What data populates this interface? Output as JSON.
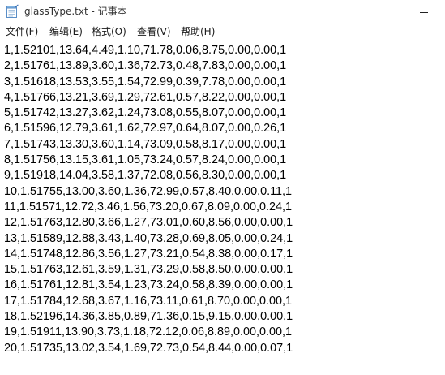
{
  "window": {
    "title": "glassType.txt - 记事本"
  },
  "icons": {
    "app": "notepad-icon",
    "minimize": "minimize-icon"
  },
  "menu": [
    "文件(F)",
    "编辑(E)",
    "格式(O)",
    "查看(V)",
    "帮助(H)"
  ],
  "document": {
    "lines": [
      "1,1.52101,13.64,4.49,1.10,71.78,0.06,8.75,0.00,0.00,1",
      "2,1.51761,13.89,3.60,1.36,72.73,0.48,7.83,0.00,0.00,1",
      "3,1.51618,13.53,3.55,1.54,72.99,0.39,7.78,0.00,0.00,1",
      "4,1.51766,13.21,3.69,1.29,72.61,0.57,8.22,0.00,0.00,1",
      "5,1.51742,13.27,3.62,1.24,73.08,0.55,8.07,0.00,0.00,1",
      "6,1.51596,12.79,3.61,1.62,72.97,0.64,8.07,0.00,0.26,1",
      "7,1.51743,13.30,3.60,1.14,73.09,0.58,8.17,0.00,0.00,1",
      "8,1.51756,13.15,3.61,1.05,73.24,0.57,8.24,0.00,0.00,1",
      "9,1.51918,14.04,3.58,1.37,72.08,0.56,8.30,0.00,0.00,1",
      "10,1.51755,13.00,3.60,1.36,72.99,0.57,8.40,0.00,0.11,1",
      "11,1.51571,12.72,3.46,1.56,73.20,0.67,8.09,0.00,0.24,1",
      "12,1.51763,12.80,3.66,1.27,73.01,0.60,8.56,0.00,0.00,1",
      "13,1.51589,12.88,3.43,1.40,73.28,0.69,8.05,0.00,0.24,1",
      "14,1.51748,12.86,3.56,1.27,73.21,0.54,8.38,0.00,0.17,1",
      "15,1.51763,12.61,3.59,1.31,73.29,0.58,8.50,0.00,0.00,1",
      "16,1.51761,12.81,3.54,1.23,73.24,0.58,8.39,0.00,0.00,1",
      "17,1.51784,12.68,3.67,1.16,73.11,0.61,8.70,0.00,0.00,1",
      "18,1.52196,14.36,3.85,0.89,71.36,0.15,9.15,0.00,0.00,1",
      "19,1.51911,13.90,3.73,1.18,72.12,0.06,8.89,0.00,0.00,1",
      "20,1.51735,13.02,3.54,1.69,72.73,0.54,8.44,0.00,0.07,1"
    ]
  }
}
